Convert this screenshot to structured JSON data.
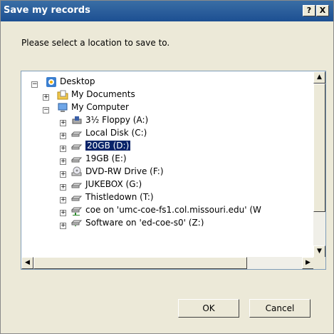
{
  "window": {
    "title": "Save my records"
  },
  "titlebar_buttons": {
    "help": "?",
    "close": "X"
  },
  "prompt": "Please select a location to save to.",
  "tree": [
    {
      "label": "Desktop",
      "icon": "desktop-icon"
    },
    {
      "label": "My Documents",
      "icon": "my-documents-folder-icon"
    },
    {
      "label": "My Computer",
      "icon": "my-computer-icon"
    },
    {
      "label": "3½ Floppy (A:)",
      "icon": "floppy-drive-icon"
    },
    {
      "label": "Local Disk (C:)",
      "icon": "hard-drive-icon"
    },
    {
      "label": "20GB (D:)",
      "icon": "hard-drive-icon",
      "selected": true
    },
    {
      "label": "19GB (E:)",
      "icon": "hard-drive-icon"
    },
    {
      "label": "DVD-RW Drive (F:)",
      "icon": "dvd-drive-icon"
    },
    {
      "label": "JUKEBOX (G:)",
      "icon": "hard-drive-icon"
    },
    {
      "label": "Thistledown (T:)",
      "icon": "hard-drive-icon"
    },
    {
      "label": "coe on 'umc-coe-fs1.col.missouri.edu' (W",
      "icon": "network-drive-icon"
    },
    {
      "label": "Software on 'ed-coe-s0' (Z:)",
      "icon": "network-drive-icon"
    }
  ],
  "buttons": {
    "ok": "OK",
    "cancel": "Cancel"
  },
  "colors": {
    "titlebar": "#1c4f92",
    "dialog": "#ece9d8",
    "selection": "#0a246a"
  }
}
